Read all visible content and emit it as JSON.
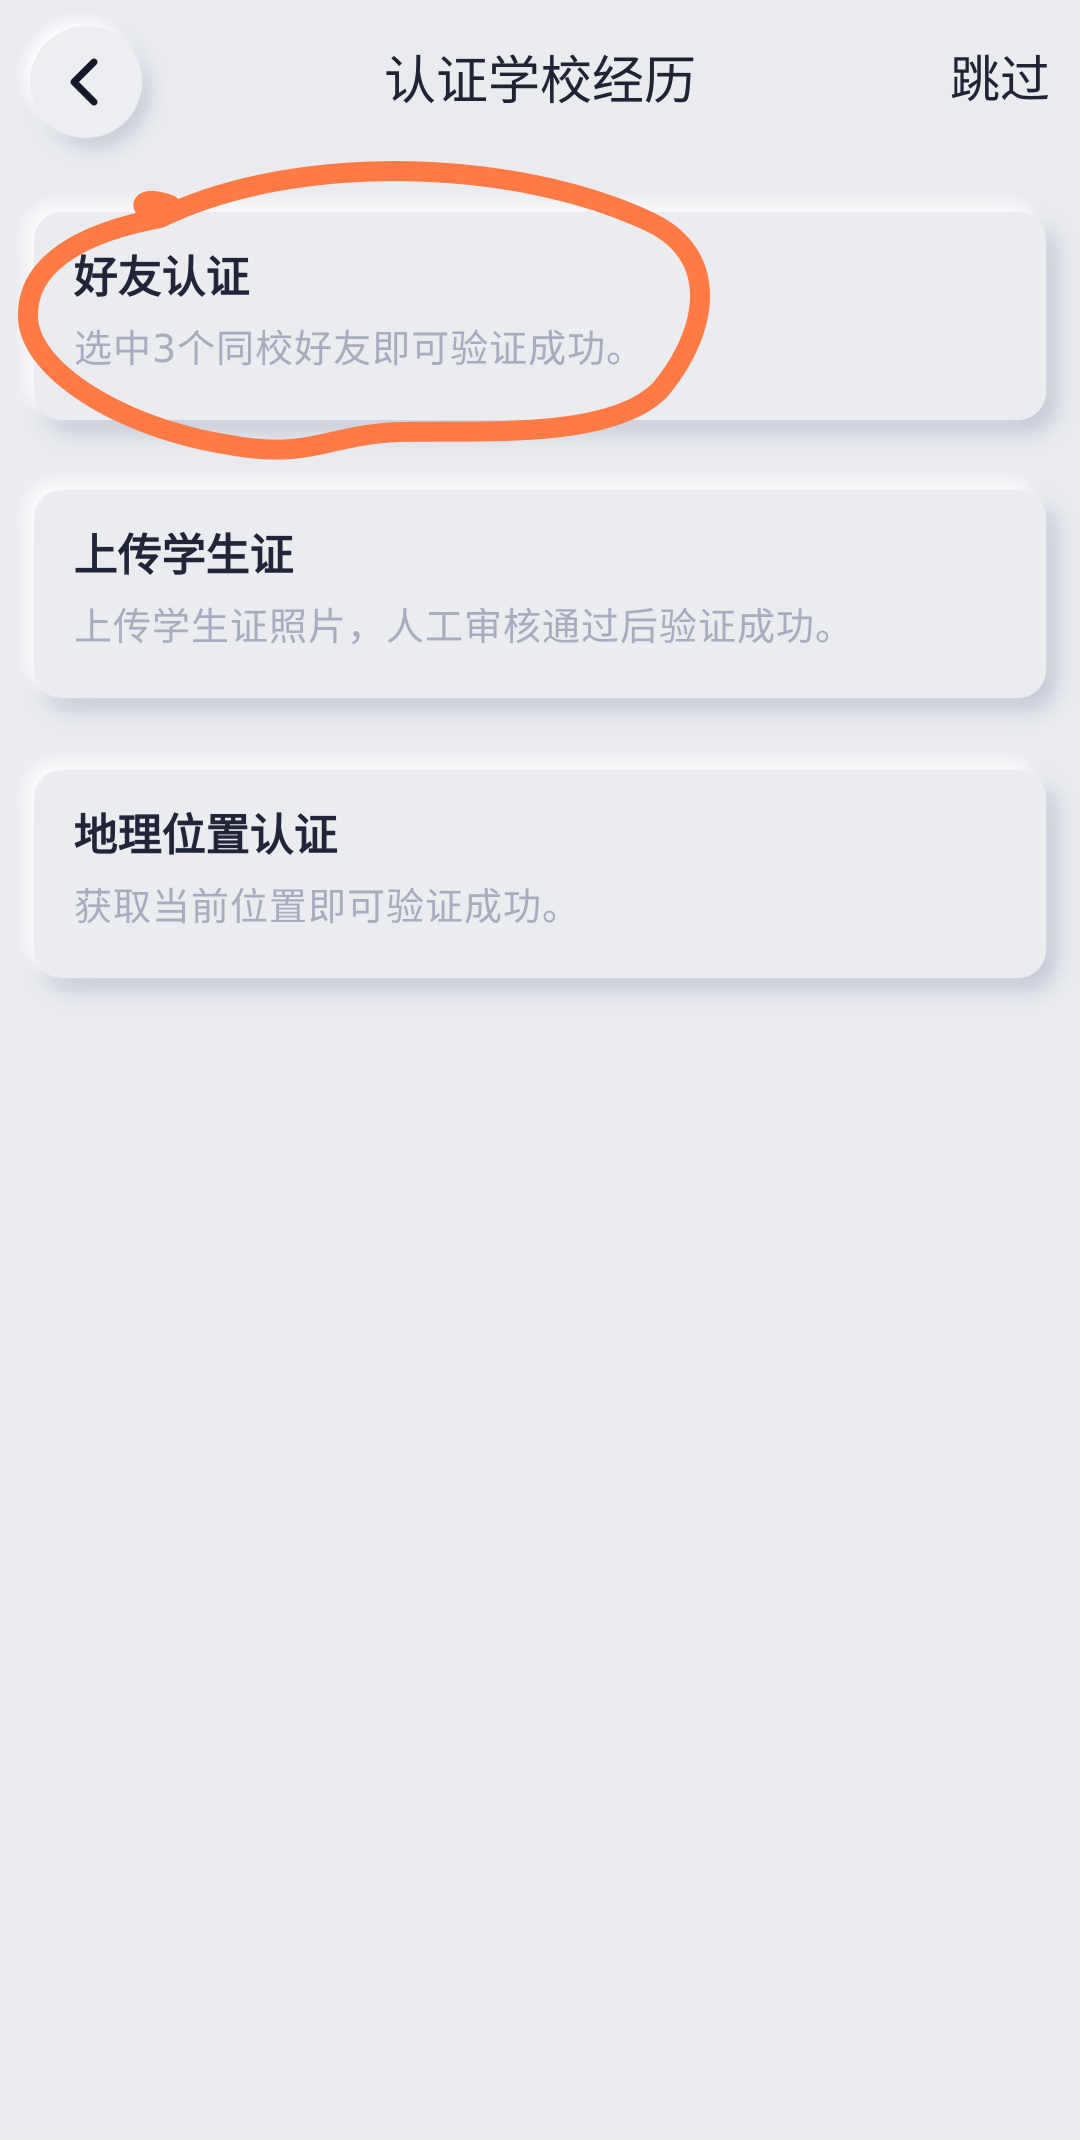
{
  "header": {
    "title": "认证学校经历",
    "skip_label": "跳过",
    "back_icon": "chevron-left-icon"
  },
  "options": [
    {
      "title": "好友认证",
      "description": "选中3个同校好友即可验证成功。"
    },
    {
      "title": "上传学生证",
      "description": "上传学生证照片，人工审核通过后验证成功。"
    },
    {
      "title": "地理位置认证",
      "description": "获取当前位置即可验证成功。"
    }
  ],
  "colors": {
    "background": "#e9ebef",
    "title_text": "#20253a",
    "desc_text": "#a7acbf",
    "highlight_stroke": "#ff7a45"
  }
}
